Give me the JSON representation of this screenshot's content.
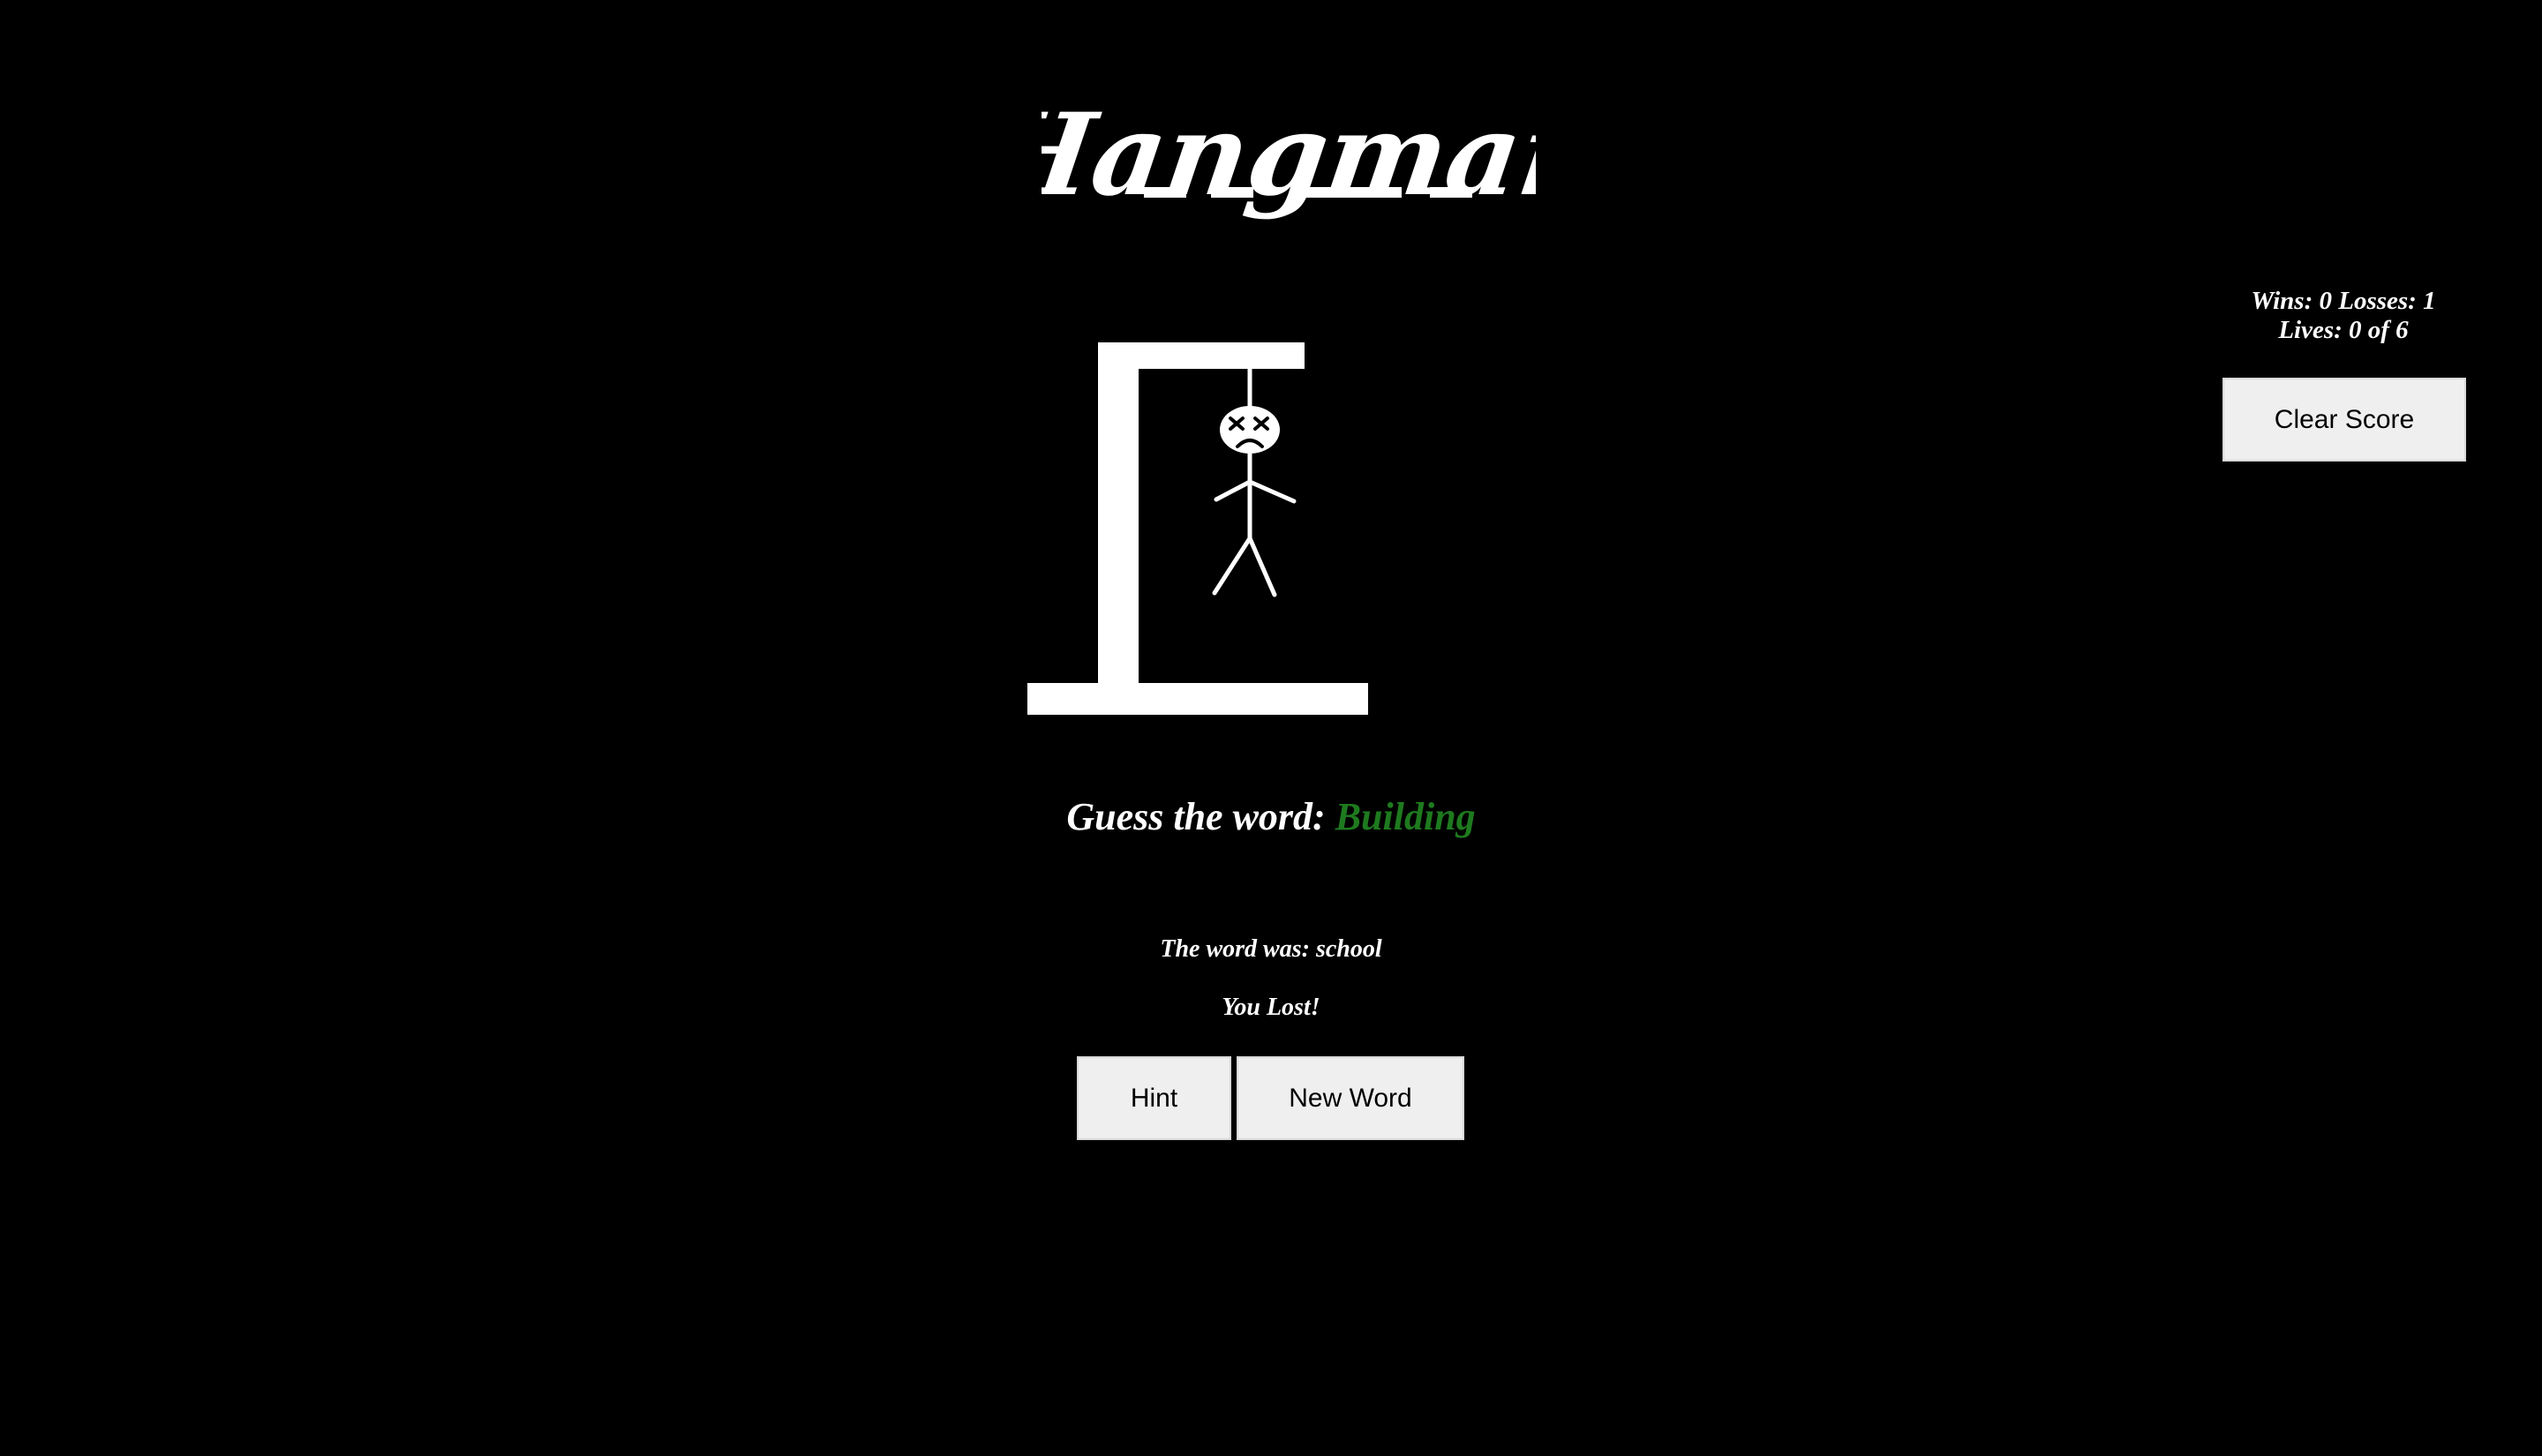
{
  "title": "Hangman",
  "scoreboard": {
    "wins_losses": "Wins: 0 Losses: 1",
    "lives": "Lives: 0 of 6"
  },
  "buttons": {
    "clear_score": "Clear Score",
    "hint": "Hint",
    "new_word": "New Word"
  },
  "guess": {
    "prompt": "Guess the word: ",
    "hint_word": "Building"
  },
  "reveal": "The word was: school",
  "result": "You Lost!",
  "colors": {
    "background": "#000000",
    "foreground": "#ffffff",
    "hint_word": "#1e7a1e",
    "button_bg": "#efefef"
  },
  "game_state": {
    "lives_remaining": 0,
    "lives_total": 6,
    "wins": 0,
    "losses": 1
  }
}
